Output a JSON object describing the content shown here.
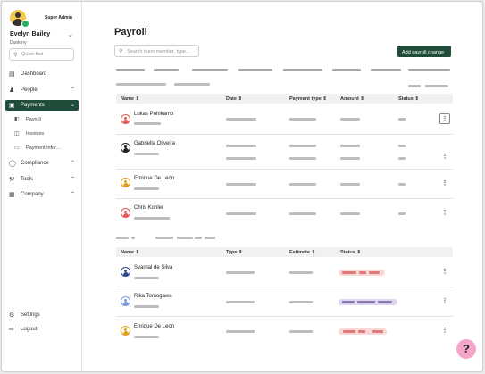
{
  "user": {
    "name": "Evelyn Bailey",
    "company": "Dunkery",
    "role": "Super Admin"
  },
  "sidebar": {
    "search_placeholder": "Quick find",
    "items": [
      {
        "label": "Dashboard",
        "icon": "dashboard-icon"
      },
      {
        "label": "People",
        "icon": "people-icon"
      },
      {
        "label": "Payments",
        "icon": "wallet-icon",
        "active": true
      },
      {
        "label": "Compliance",
        "icon": "shield-icon"
      },
      {
        "label": "Tools",
        "icon": "tools-icon"
      },
      {
        "label": "Company",
        "icon": "building-icon"
      }
    ],
    "sub_items": [
      {
        "label": "Payroll",
        "icon": "document-icon"
      },
      {
        "label": "Invoices",
        "icon": "invoice-icon"
      },
      {
        "label": "Payment infor…",
        "icon": "folder-icon"
      }
    ],
    "bottom": [
      {
        "label": "Settings",
        "icon": "gear-icon"
      },
      {
        "label": "Logout",
        "icon": "logout-icon"
      }
    ]
  },
  "main": {
    "title": "Payroll",
    "search_placeholder": "Search team member, type...",
    "add_button": "Add payroll change"
  },
  "table1": {
    "headers": [
      "Name ⇕",
      "Date ⇕",
      "Payment type ⇕",
      "Amount ⇕",
      "Status ⇕"
    ],
    "rows": [
      {
        "name": "Lukas Pohlkamp",
        "avatar_color": "#e05a5a"
      },
      {
        "name": "Gabriella Oliveira",
        "avatar_color": "#222222"
      },
      {
        "name": "Enrique De Leon",
        "avatar_color": "#e0a020"
      },
      {
        "name": "Chris Kohler",
        "avatar_color": "#e05a5a"
      }
    ]
  },
  "table2": {
    "headers": [
      "Name ⇕",
      "Type ⇕",
      "Estimate ⇕",
      "Status ⇕"
    ],
    "rows": [
      {
        "name": "Svarnal de Silva",
        "avatar_color": "#2d4a8a",
        "status_color": "#f8d7d7"
      },
      {
        "name": "Rika Tomogawa",
        "avatar_color": "#7a9be0",
        "status_color": "#ddd4f0"
      },
      {
        "name": "Enrique De Leon",
        "avatar_color": "#e0a020",
        "status_color": "#f8d7d7"
      }
    ]
  },
  "help": {
    "label": "?"
  }
}
